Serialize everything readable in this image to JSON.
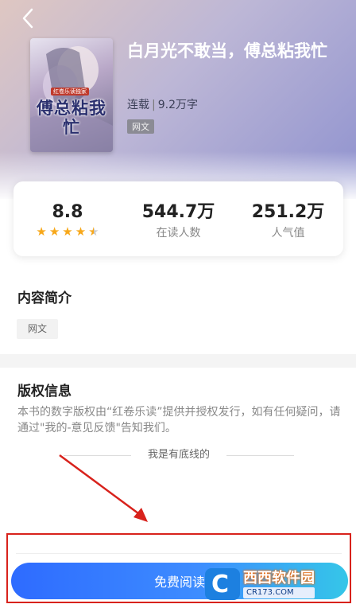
{
  "book": {
    "title": "白月光不敢当，傅总粘我忙",
    "status": "连载",
    "separator": "|",
    "word_count": "9.2万字",
    "tag": "网文",
    "cover": {
      "tag_text": "红卷乐读独家",
      "title_text": "傅总粘我忙"
    }
  },
  "stats": {
    "rating": "8.8",
    "stars_value": 4.5,
    "readers_value": "544.7万",
    "readers_label": "在读人数",
    "popularity_value": "251.2万",
    "popularity_label": "人气值"
  },
  "intro": {
    "heading": "内容简介",
    "tag": "网文"
  },
  "copyright": {
    "heading": "版权信息",
    "text": "本书的数字版权由“红卷乐读”提供并授权发行，如有任何疑问，请通过\"我的-意见反馈\"告知我们。"
  },
  "footer": {
    "bottom_text": "我是有底线的"
  },
  "action": {
    "read_label": "免费阅读"
  },
  "watermark": {
    "main": "西西软件园",
    "sub": "CR173.COM"
  },
  "annotation_color": "#d8221c",
  "icons": {
    "back": "chevron-left-icon",
    "star": "star-icon"
  }
}
